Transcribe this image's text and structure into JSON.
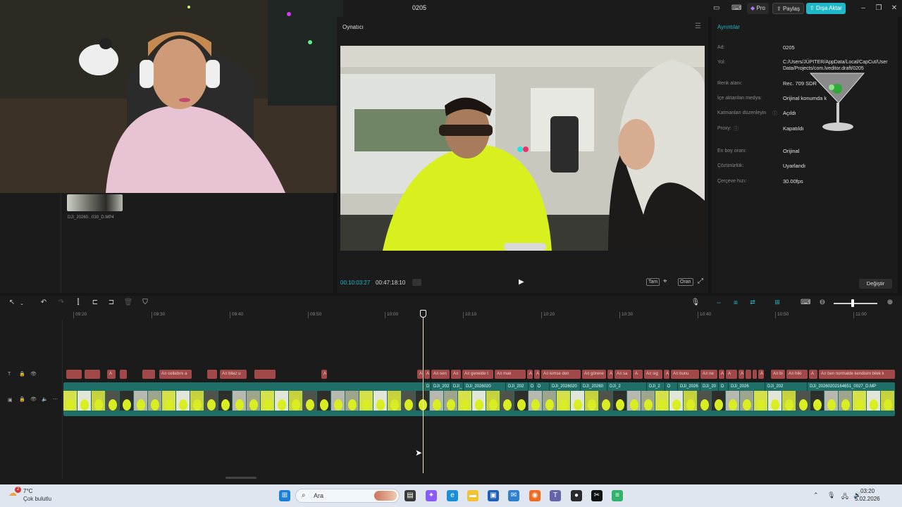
{
  "window": {
    "title": "0205",
    "pro_label": "Pro",
    "share_label": "Paylaş",
    "export_label": "Dışa Aktar"
  },
  "media": {
    "file_name": "DJI_20260...030_D.MP4"
  },
  "player": {
    "title": "Oynatıcı",
    "current_time": "00:10:03:27",
    "total_time": "00:47:18:10",
    "full_label": "Tam",
    "ratio_label": "Oran"
  },
  "details": {
    "title": "Ayrıntılar",
    "rows": [
      {
        "label": "Ad:",
        "value": "0205"
      },
      {
        "label": "Yol:",
        "value": "C:/Users/JÜPITER/AppData/Local/CapCut/User Data/Projects/com.lveditor.draft/0205"
      },
      {
        "label": "Renk alanı:",
        "value": "Rec. 709 SDR"
      },
      {
        "label": "İçe aktarılan medya:",
        "value": "Orijinal konumda k"
      },
      {
        "label": "Katmanları düzenleyin",
        "value": "Açıldı"
      },
      {
        "label": "Proxy:",
        "value": "Kapatıldı"
      },
      {
        "label": "En boy oranı:",
        "value": "Orijinal"
      },
      {
        "label": "Çözünürlük:",
        "value": "Uyarlandı"
      },
      {
        "label": "Çerçeve hızı:",
        "value": "30.00fps"
      }
    ],
    "change_label": "Değiştir"
  },
  "timeline": {
    "ruler": [
      "09:20",
      "09:30",
      "09:40",
      "09:50",
      "10:00",
      "10:10",
      "10:20",
      "10:30",
      "10:40",
      "10:50",
      "11:00"
    ],
    "text_clips": [
      "A",
      "A",
      "A",
      "A",
      "A",
      "A≡ cellabını a",
      "A",
      "A≡ bilaz u",
      "A",
      "A",
      "A",
      "A≡",
      "A≡ sen",
      "A≡",
      "A≡ genelde t",
      "A≡ mak",
      "A",
      "A",
      "A≡ kimse den",
      "A≡ görene",
      "A≡ sa",
      "A≡ sig",
      "A≡ bunu",
      "A≡ ne",
      "A≡ bi",
      "A≡ hiki",
      "A≡ ben normalde kendisini bilek k"
    ],
    "video_clips": [
      "D",
      "DJI_202",
      "DJI_",
      "DJI_2026020",
      "DJI_202",
      "D",
      "D",
      "DJI_2026020",
      "DJI_20260",
      "DJI_2",
      "DJI_2",
      "D",
      "DJI_2026",
      "DJI_20",
      "D",
      "DJI_2026",
      "DJI_202",
      "DJI_20260202164651_0027_D.MP"
    ]
  },
  "taskbar": {
    "weather_temp": "7°C",
    "weather_desc": "Çok bulutlu",
    "search_placeholder": "Ara",
    "time": "03:20",
    "date": "5.02.2026",
    "weather_badge": "2"
  }
}
